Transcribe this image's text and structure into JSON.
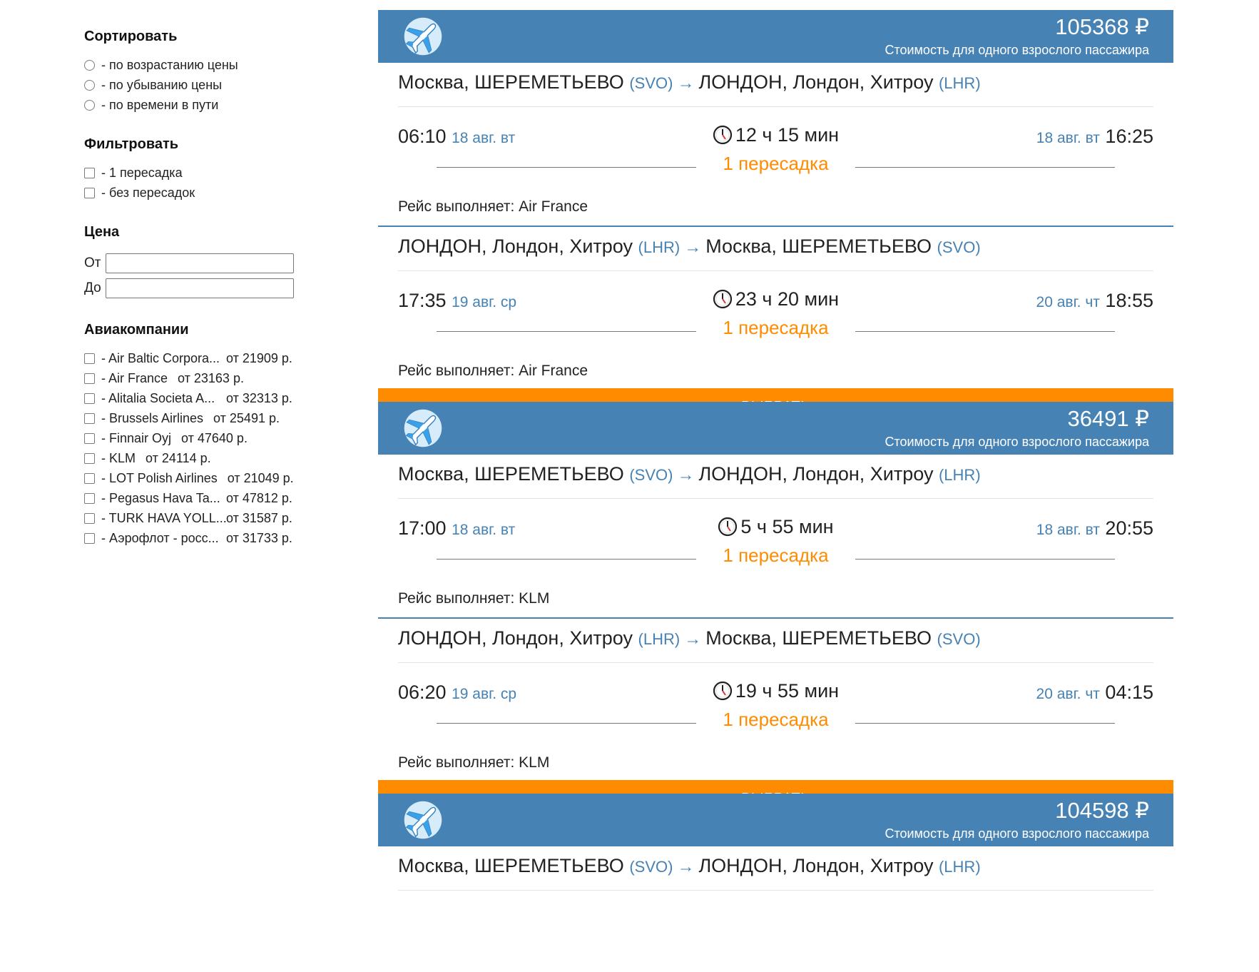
{
  "sidebar": {
    "sort": {
      "heading": "Сортировать",
      "options": [
        "- по возрастанию цены",
        "- по убыванию цены",
        "- по времени в пути"
      ]
    },
    "filter": {
      "heading": "Фильтровать",
      "options": [
        "- 1 пересадка",
        "- без пересадок"
      ]
    },
    "price": {
      "heading": "Цена",
      "from_label": "От",
      "to_label": "До",
      "from_value": "",
      "to_value": ""
    },
    "airlines": {
      "heading": "Авиакомпании",
      "items": [
        {
          "name": "- Air Baltic Corpora...",
          "price": "от 21909 р."
        },
        {
          "name": "- Air France",
          "price": "от 23163 р."
        },
        {
          "name": "- Alitalia Societa A...",
          "price": "от 32313 р."
        },
        {
          "name": "- Brussels Airlines",
          "price": "от 25491 р."
        },
        {
          "name": "- Finnair Oyj",
          "price": "от 47640 р."
        },
        {
          "name": "- KLM",
          "price": "от 24114 р."
        },
        {
          "name": "- LOT Polish Airlines",
          "price": "от 21049 р."
        },
        {
          "name": "- Pegasus Hava Ta...",
          "price": "от 47812 р."
        },
        {
          "name": "- TURK HAVA YOLL...",
          "price": "от 31587 р."
        },
        {
          "name": "- Аэрофлот - росс...",
          "price": "от 31733 р."
        }
      ]
    }
  },
  "colors": {
    "header_blue": "#4682b4",
    "accent_orange": "#ff8c00"
  },
  "icons": {
    "plane": "plane-icon",
    "clock": "clock-icon",
    "arrow": "arrow-right-icon"
  },
  "price_note": "Стоимость для одного взрослого пассажира",
  "select_label": "ВЫБРАТЬ",
  "cards": [
    {
      "price": "105368 ₽",
      "legs": [
        {
          "from": "Москва, ШЕРЕМЕТЬЕВО",
          "from_code": "(SVO)",
          "to": "ЛОНДОН, Лондон, Хитроу",
          "to_code": "(LHR)",
          "dep_time": "06:10",
          "dep_date": "18 авг. вт",
          "duration": "12 ч 15 мин",
          "stops": "1 пересадка",
          "arr_date": "18 авг. вт",
          "arr_time": "16:25",
          "carrier": "Рейс выполняет: Air France"
        },
        {
          "from": "ЛОНДОН, Лондон, Хитроу",
          "from_code": "(LHR)",
          "to": "Москва, ШЕРЕМЕТЬЕВО",
          "to_code": "(SVO)",
          "dep_time": "17:35",
          "dep_date": "19 авг. ср",
          "duration": "23 ч 20 мин",
          "stops": "1 пересадка",
          "arr_date": "20 авг. чт",
          "arr_time": "18:55",
          "carrier": "Рейс выполняет: Air France"
        }
      ]
    },
    {
      "price": "36491 ₽",
      "legs": [
        {
          "from": "Москва, ШЕРЕМЕТЬЕВО",
          "from_code": "(SVO)",
          "to": "ЛОНДОН, Лондон, Хитроу",
          "to_code": "(LHR)",
          "dep_time": "17:00",
          "dep_date": "18 авг. вт",
          "duration": "5 ч 55 мин",
          "stops": "1 пересадка",
          "arr_date": "18 авг. вт",
          "arr_time": "20:55",
          "carrier": "Рейс выполняет: KLM"
        },
        {
          "from": "ЛОНДОН, Лондон, Хитроу",
          "from_code": "(LHR)",
          "to": "Москва, ШЕРЕМЕТЬЕВО",
          "to_code": "(SVO)",
          "dep_time": "06:20",
          "dep_date": "19 авг. ср",
          "duration": "19 ч 55 мин",
          "stops": "1 пересадка",
          "arr_date": "20 авг. чт",
          "arr_time": "04:15",
          "carrier": "Рейс выполняет: KLM"
        }
      ]
    },
    {
      "price": "104598 ₽",
      "legs": [
        {
          "from": "Москва, ШЕРЕМЕТЬЕВО",
          "from_code": "(SVO)",
          "to": "ЛОНДОН, Лондон, Хитроу",
          "to_code": "(LHR)"
        }
      ]
    }
  ]
}
